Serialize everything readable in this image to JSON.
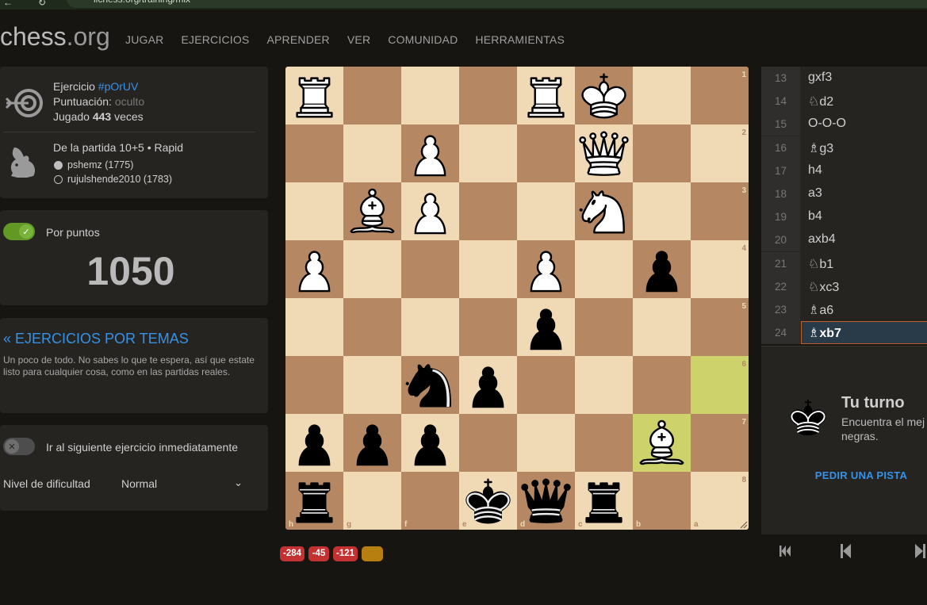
{
  "browser": {
    "url": "lichess.org/training/mix"
  },
  "header": {
    "logo_main": "chess",
    "logo_suffix": ".org",
    "nav": [
      "JUGAR",
      "EJERCICIOS",
      "APRENDER",
      "VER",
      "COMUNIDAD",
      "HERRAMIENTAS"
    ]
  },
  "puzzle_info": {
    "exercise_prefix": "Ejercicio ",
    "exercise_id": "#pOrUV",
    "rating_label": "Puntuación: ",
    "rating_value": "oculto",
    "played_prefix": "Jugado ",
    "played_count": "443",
    "played_suffix": " veces",
    "game_desc": "De la partida 10+5 • Rapid",
    "player_white": "pshemz (1775)",
    "player_black": "rujulshende2010 (1783)"
  },
  "score": {
    "toggle_label": "Por puntos",
    "toggle_on": true,
    "value": "1050"
  },
  "themes": {
    "link": "« EJERCICIOS POR TEMAS",
    "description": "Un poco de todo. No sabes lo que te espera, así que estate listo para cualquier cosa, como en las partidas reales."
  },
  "settings": {
    "next_label": "Ir al siguiente ejercicio inmediatamente",
    "next_on": false,
    "difficulty_label": "Nivel de dificultad",
    "difficulty_value": "Normal"
  },
  "board": {
    "orientation": "black",
    "rank_labels": [
      "1",
      "2",
      "3",
      "4",
      "5",
      "6",
      "7",
      "8"
    ],
    "file_labels": [
      "h",
      "g",
      "f",
      "e",
      "d",
      "c",
      "b",
      "a"
    ],
    "last_move": [
      "a6",
      "b7"
    ],
    "pieces": [
      {
        "sq": "h1",
        "p": "wR"
      },
      {
        "sq": "d1",
        "p": "wR"
      },
      {
        "sq": "c1",
        "p": "wK"
      },
      {
        "sq": "f2",
        "p": "wP"
      },
      {
        "sq": "c2",
        "p": "wQ"
      },
      {
        "sq": "g3",
        "p": "wB"
      },
      {
        "sq": "f3",
        "p": "wP"
      },
      {
        "sq": "c3",
        "p": "wN"
      },
      {
        "sq": "h4",
        "p": "wP"
      },
      {
        "sq": "d4",
        "p": "wP"
      },
      {
        "sq": "b4",
        "p": "bP"
      },
      {
        "sq": "d5",
        "p": "bP"
      },
      {
        "sq": "f6",
        "p": "bN"
      },
      {
        "sq": "e6",
        "p": "bP"
      },
      {
        "sq": "h7",
        "p": "bP"
      },
      {
        "sq": "g7",
        "p": "bP"
      },
      {
        "sq": "f7",
        "p": "bP"
      },
      {
        "sq": "b7",
        "p": "wB"
      },
      {
        "sq": "h8",
        "p": "bR"
      },
      {
        "sq": "e8",
        "p": "bK"
      },
      {
        "sq": "d8",
        "p": "bQ"
      },
      {
        "sq": "c8",
        "p": "bR"
      }
    ]
  },
  "eval_chips": [
    "-284",
    "-45",
    "-121",
    ""
  ],
  "moves": [
    {
      "num": "13",
      "san": "gxf3"
    },
    {
      "num": "14",
      "san": "♘d2"
    },
    {
      "num": "15",
      "san": "O-O-O"
    },
    {
      "num": "16",
      "san": "♗g3"
    },
    {
      "num": "17",
      "san": "h4"
    },
    {
      "num": "18",
      "san": "a3"
    },
    {
      "num": "19",
      "san": "b4"
    },
    {
      "num": "20",
      "san": "axb4"
    },
    {
      "num": "21",
      "san": "♘b1"
    },
    {
      "num": "22",
      "san": "♘xc3"
    },
    {
      "num": "23",
      "san": "♗a6"
    },
    {
      "num": "24",
      "san": "♗xb7",
      "active": true
    }
  ],
  "turn": {
    "title": "Tu turno",
    "description_line1": "Encuentra el mej",
    "description_line2": "negras.",
    "hint": "PEDIR UNA PISTA"
  },
  "colors": {
    "light_square": "#f0d9b5",
    "dark_square": "#b58863",
    "highlight": "#cdd26a",
    "accent": "#3692e7"
  }
}
